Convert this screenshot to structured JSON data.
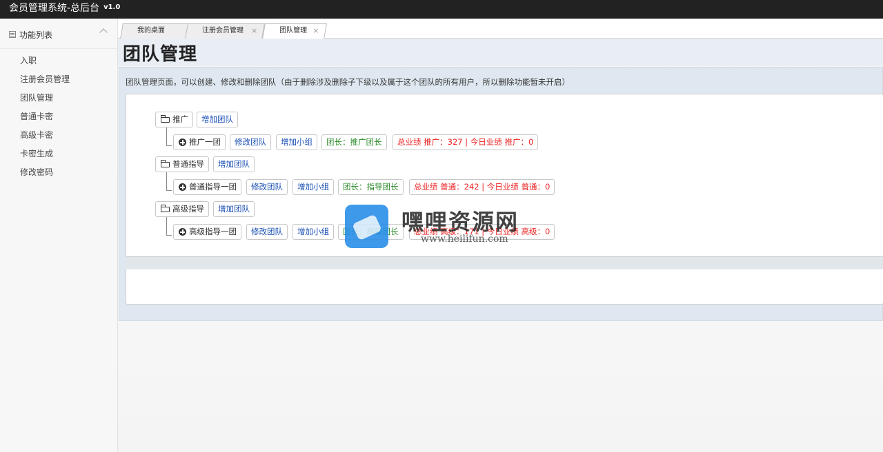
{
  "app": {
    "title": "会员管理系统-总后台",
    "version": "v1.0"
  },
  "sidebar": {
    "header": "功能列表",
    "items": [
      {
        "label": "入职"
      },
      {
        "label": "注册会员管理"
      },
      {
        "label": "团队管理"
      },
      {
        "label": "普通卡密"
      },
      {
        "label": "高级卡密"
      },
      {
        "label": "卡密生成"
      },
      {
        "label": "修改密码"
      }
    ]
  },
  "tabs": [
    {
      "label": "我的桌面",
      "closable": false
    },
    {
      "label": "注册会员管理",
      "closable": true,
      "close": "×"
    },
    {
      "label": "团队管理",
      "closable": true,
      "close": "×",
      "active": true
    }
  ],
  "page": {
    "title": "团队管理",
    "description": "团队管理页面，可以创建、修改和删除团队（由于删除涉及删除子下级以及属于这个团队的所有用户，所以删除功能暂未开启）"
  },
  "teams": [
    {
      "name": "推广",
      "add_team": "增加团队",
      "group": {
        "name": "推广一团",
        "edit": "修改团队",
        "add_group": "增加小组",
        "leader": "团长：推广团长",
        "stats": "总业绩 推广：327 | 今日业绩 推广：0"
      }
    },
    {
      "name": "普通指导",
      "add_team": "增加团队",
      "group": {
        "name": "普通指导一团",
        "edit": "修改团队",
        "add_group": "增加小组",
        "leader": "团长：指导团长",
        "stats": "总业绩 普通：242 | 今日业绩 普通：0"
      }
    },
    {
      "name": "高级指导",
      "add_team": "增加团队",
      "group": {
        "name": "高级指导一团",
        "edit": "修改团队",
        "add_group": "增加小组",
        "leader": "团长：高级团长",
        "stats": "总业绩 高级：171 | 今日业绩 高级：0"
      }
    }
  ],
  "watermark": {
    "cn": "嘿哩资源网",
    "en": "www.heilifun.com"
  },
  "colors": {
    "topbar": "#222222",
    "link_blue": "#1a4fb4",
    "leader_green": "#2a8a2a",
    "stats_red": "#ee2222"
  }
}
